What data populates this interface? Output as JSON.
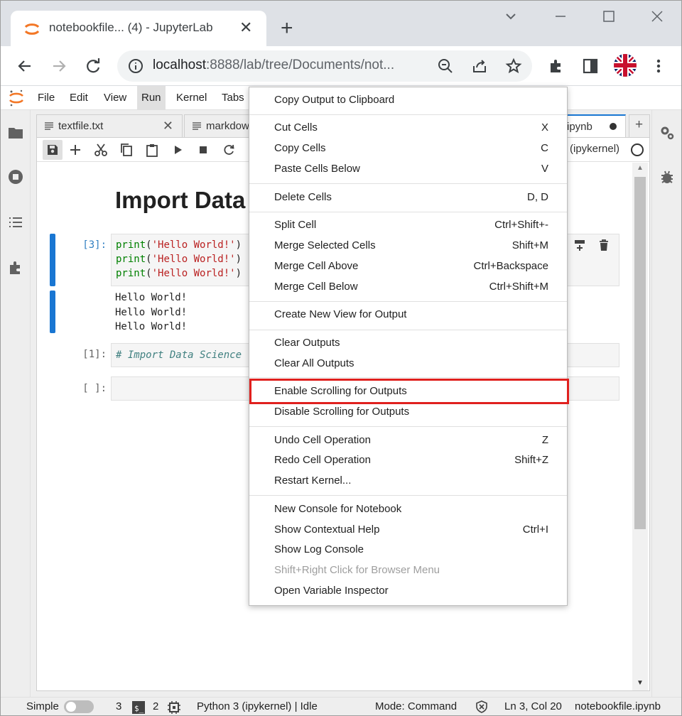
{
  "browser": {
    "tab_title": "notebookfile... (4) - JupyterLab",
    "new_tab_label": "+",
    "url_host": "localhost",
    "url_path": ":8888/lab/tree/Documents/not..."
  },
  "menubar": {
    "items": [
      "File",
      "Edit",
      "View",
      "Run",
      "Kernel",
      "Tabs"
    ]
  },
  "dock_tabs": [
    {
      "label": "textfile.txt"
    },
    {
      "label": "markdow"
    },
    {
      "label": "ipynb"
    }
  ],
  "notebook": {
    "kernel_label": "(ipykernel)",
    "heading": "Import Data",
    "cells": [
      {
        "prompt": "[3]:",
        "lines": [
          "print('Hello World!')",
          "print('Hello World!')",
          "print('Hello World!')"
        ]
      },
      {
        "output": [
          "Hello World!",
          "Hello World!",
          "Hello World!"
        ]
      },
      {
        "prompt": "[1]:",
        "comment": "# Import Data Science"
      },
      {
        "prompt": "[ ]:"
      }
    ]
  },
  "context_menu": {
    "items": [
      {
        "label": "Copy Output to Clipboard",
        "shortcut": ""
      },
      {
        "label": "Cut Cells",
        "shortcut": "X"
      },
      {
        "label": "Copy Cells",
        "shortcut": "C"
      },
      {
        "label": "Paste Cells Below",
        "shortcut": "V"
      },
      {
        "label": "Delete Cells",
        "shortcut": "D, D"
      },
      {
        "label": "Split Cell",
        "shortcut": "Ctrl+Shift+-"
      },
      {
        "label": "Merge Selected Cells",
        "shortcut": "Shift+M"
      },
      {
        "label": "Merge Cell Above",
        "shortcut": "Ctrl+Backspace"
      },
      {
        "label": "Merge Cell Below",
        "shortcut": "Ctrl+Shift+M"
      },
      {
        "label": "Create New View for Output",
        "shortcut": ""
      },
      {
        "label": "Clear Outputs",
        "shortcut": ""
      },
      {
        "label": "Clear All Outputs",
        "shortcut": ""
      },
      {
        "label": "Enable Scrolling for Outputs",
        "shortcut": ""
      },
      {
        "label": "Disable Scrolling for Outputs",
        "shortcut": ""
      },
      {
        "label": "Undo Cell Operation",
        "shortcut": "Z"
      },
      {
        "label": "Redo Cell Operation",
        "shortcut": "Shift+Z"
      },
      {
        "label": "Restart Kernel...",
        "shortcut": ""
      },
      {
        "label": "New Console for Notebook",
        "shortcut": ""
      },
      {
        "label": "Show Contextual Help",
        "shortcut": "Ctrl+I"
      },
      {
        "label": "Show Log Console",
        "shortcut": ""
      },
      {
        "label": "Shift+Right Click for Browser Menu",
        "shortcut": "",
        "disabled": true
      },
      {
        "label": "Open Variable Inspector",
        "shortcut": ""
      }
    ]
  },
  "statusbar": {
    "mode_label": "Simple",
    "terminals_count": "3",
    "kernels_count": "2",
    "kernel_status": "Python 3 (ipykernel) | Idle",
    "command_mode": "Mode: Command",
    "cursor_pos": "Ln 3, Col 20",
    "file_name": "notebookfile.ipynb"
  },
  "colors": {
    "accent": "#1976d2",
    "highlight_box": "#e0201e",
    "jupyter_orange": "#f37726"
  }
}
